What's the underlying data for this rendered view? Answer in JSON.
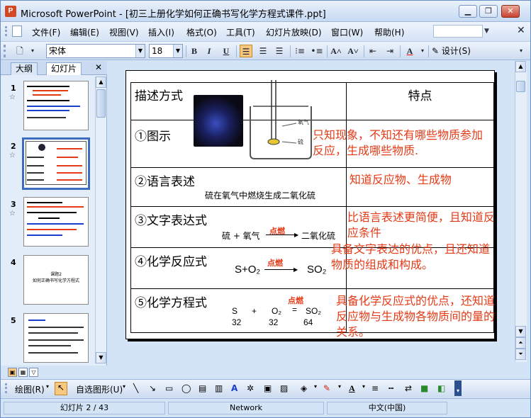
{
  "window": {
    "title": "Microsoft PowerPoint - [初三上册化学如何正确书写化学方程式课件.ppt]",
    "app_icon": "P"
  },
  "menu": [
    "文件(F)",
    "编辑(E)",
    "视图(V)",
    "插入(I)",
    "格式(O)",
    "工具(T)",
    "幻灯片放映(D)",
    "窗口(W)",
    "帮助(H)"
  ],
  "toolbar": {
    "font_name": "宋体",
    "font_size": "18",
    "bold": "B",
    "italic": "I",
    "underline": "U",
    "design_label": "设计(S)"
  },
  "left_pane": {
    "tabs": [
      "大纲",
      "幻灯片"
    ],
    "slides": [
      {
        "number": "1",
        "star": "☆"
      },
      {
        "number": "2",
        "star": "☆"
      },
      {
        "number": "3",
        "star": "☆"
      },
      {
        "number": "4",
        "star": ""
      },
      {
        "number": "5",
        "star": ""
      }
    ],
    "thumb4_text": "课题2\n如何正确书写化学方程式"
  },
  "slide": {
    "header_left": "描述方式",
    "header_right": "特点",
    "rows": [
      {
        "label": "①图示",
        "note": "只知现象，不知还有哪些物质参加反应，生成哪些物质."
      },
      {
        "label": "②语言表述",
        "sub": "硫在氧气中燃烧生成二氧化硫",
        "note": "知道反应物、生成物"
      },
      {
        "label": "③文字表达式",
        "reactants": "硫 + 氧气",
        "condition": "点燃",
        "product": "二氧化硫",
        "note": "比语言表述更简便，且知道反应条件"
      },
      {
        "label": "④化学反应式",
        "reactants": "S+O₂",
        "condition": "点燃",
        "product": "SO₂",
        "note": "具备文字表达的优点，且还知道物质的组成和构成。"
      },
      {
        "label": "⑤化学方程式",
        "condition": "点燃",
        "eq_top": [
          "S",
          "+",
          "O₂",
          "=",
          "SO₂"
        ],
        "eq_bottom": [
          "32",
          "32",
          "64"
        ],
        "note": "具备化学反应式的优点，还知道反应物与生成物各物质间的量的关系。"
      }
    ],
    "image_labels": {
      "oxygen": "氧气",
      "sulfur": "硫"
    }
  },
  "drawbar": {
    "draw_label": "绘图(R)",
    "autoshape_label": "自选图形(U)"
  },
  "status": {
    "slide_info": "幻灯片 2 / 43",
    "theme": "Network",
    "language": "中文(中国)"
  }
}
